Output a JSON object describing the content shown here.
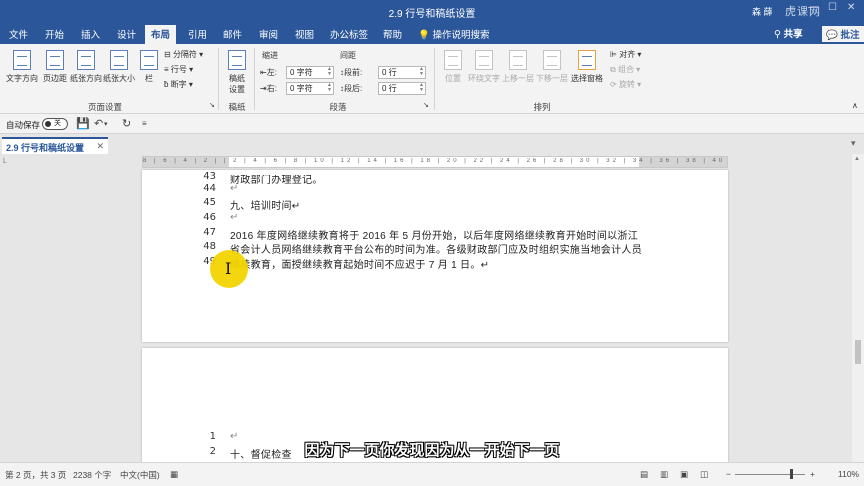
{
  "window": {
    "title": "2.9 行号和稿纸设置",
    "user": "森 薛",
    "watermark": "虎课网"
  },
  "ribbon_tabs": [
    "文件",
    "开始",
    "插入",
    "设计",
    "布局",
    "引用",
    "邮件",
    "审阅",
    "视图",
    "办公标签",
    "帮助"
  ],
  "active_tab": "布局",
  "tell_me": "操作说明搜索",
  "share_label": "共享",
  "comments_label": "批注",
  "page_setup": {
    "text_direction": "文字方向",
    "margins": "页边距",
    "orientation": "纸张方向",
    "size": "纸张大小",
    "columns": "栏",
    "breaks": "分隔符",
    "line_numbers": "行号",
    "hyphenation": "断字",
    "group_label": "页面设置"
  },
  "manuscript": {
    "label": "稿纸\n设置",
    "group_label": "稿纸"
  },
  "paragraph": {
    "indent_header": "缩进",
    "spacing_header": "间距",
    "left_label": "左:",
    "left_value": "0 字符",
    "right_label": "右:",
    "right_value": "0 字符",
    "before_label": "段前:",
    "before_value": "0 行",
    "after_label": "段后:",
    "after_value": "0 行",
    "group_label": "段落"
  },
  "arrange": {
    "position": "位置",
    "wrap_text": "环绕文字",
    "bring_forward": "上移一层",
    "send_backward": "下移一层",
    "selection_pane": "选择窗格",
    "align": "对齐",
    "group": "组合",
    "rotate": "旋转",
    "group_label": "排列"
  },
  "qat": {
    "autosave_label": "自动保存",
    "autosave_state": "关"
  },
  "doc_tab": {
    "title": "2.9 行号和稿纸设置"
  },
  "ruler_ticks": "8 | 6 | 4 | 2 | | 2 | 4 | 6 | 8 | 10 | 12 | 14 | 16 | 18 | 20 | 22 | 24 | 26 | 28 | 30 | 32 | 34 | 36 | 38 | 40 | 42 | 44 | 46 | 48 |",
  "page1_lines": [
    {
      "num": "43",
      "text": "财政部门办理登记。"
    },
    {
      "num": "44",
      "text": "↵"
    },
    {
      "num": "45",
      "text": "九、培训时间↵"
    },
    {
      "num": "46",
      "text": "↵"
    },
    {
      "num": "47",
      "text": "2016 年度网络继续教育将于 2016 年 5 月份开始，以后年度网络继续教育开始时间以浙江"
    },
    {
      "num": "48",
      "text": "省会计人员网络继续教育平台公布的时间为准。各级财政部门应及时组织实施当地会计人员"
    },
    {
      "num": "49",
      "text": "继续教育，面授继续教育起始时间不应迟于 7 月 1 日。↵"
    }
  ],
  "page2_lines": [
    {
      "num": "1",
      "text": "↵"
    },
    {
      "num": "2",
      "text": "十、督促检查"
    }
  ],
  "subtitle": "因为下一页你发现因为从一开始下一页",
  "status": {
    "page": "第 2 页，共 3 页",
    "words": "2238 个字",
    "language": "中文(中国)",
    "zoom": "110%"
  }
}
